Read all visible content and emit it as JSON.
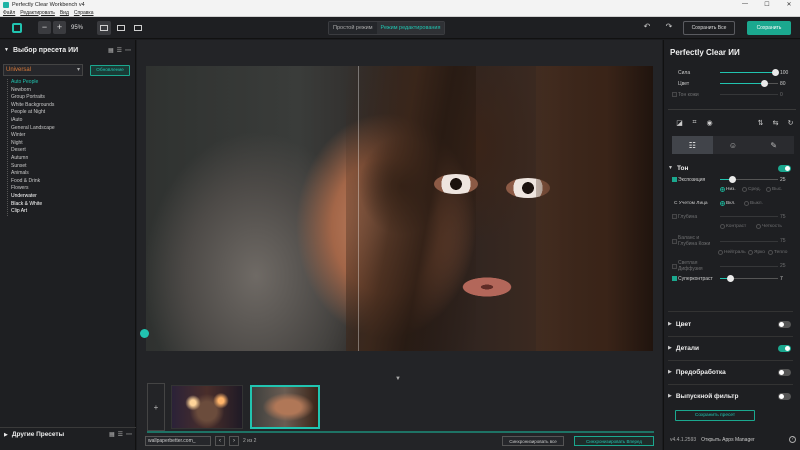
{
  "window": {
    "title": "Perfectly Clear Workbench v4",
    "minimize": "—",
    "maximize": "☐",
    "close": "✕"
  },
  "menu": [
    "Файл",
    "Редактировать",
    "Вид",
    "Справка"
  ],
  "toolbar": {
    "zoom_minus": "−",
    "zoom_plus": "+",
    "zoom_value": "95%",
    "mode_simple": "Простой режим",
    "mode_edit": "Режим редактирования",
    "undo": "↶",
    "redo": "↷",
    "save_all": "Сохранить Все",
    "save": "Сохранить"
  },
  "left_panel": {
    "title": "Выбор пресета ИИ",
    "selected_preset": "Universal",
    "refresh_label": "Обновление",
    "presets": [
      "Auto People",
      "Newborn",
      "Group Portraits",
      "White Backgrounds",
      "People at Night",
      "iAuto",
      "General Landscape",
      "Winter",
      "Night",
      "Desert",
      "Autumn",
      "Sunset",
      "Animals",
      "Food & Drink",
      "Flowers",
      "Underwater",
      "Black & White",
      "Clip Art"
    ],
    "other_presets": "Другие Пресеты"
  },
  "bottom": {
    "file_name": "wallpaperbetter.com_",
    "prev": "‹",
    "next": "›",
    "count": "2 из 2",
    "sync_all": "Синхронизировать все",
    "sync_prev": "Синхронизировать Вперед"
  },
  "right_panel": {
    "title": "Perfectly Clear ИИ",
    "sliders": [
      {
        "label": "Сила",
        "value": "100",
        "fraction": 0.95
      },
      {
        "label": "Цвет",
        "value": "80",
        "fraction": 0.76
      }
    ],
    "skin_tone": {
      "label": "Тон кожи",
      "value": "0"
    },
    "tone": {
      "title": "Тон",
      "exposure": {
        "label": "Экспозиция",
        "value": "25",
        "fraction": 0.2
      },
      "exposure_modes": [
        "Низ.",
        "Сред.",
        "Выс."
      ],
      "face_aware_label": "С Учетом Лица",
      "face_aware_modes": [
        "Вкл.",
        "Выкл."
      ],
      "depth": {
        "label": "Глубина",
        "value": "75"
      },
      "depth_modes": [
        "Контраст",
        "Четкость"
      ],
      "skin_balance": {
        "label": "Баланс и Глубина Кожи",
        "value": "75"
      },
      "skin_modes": [
        "Нейтраль",
        "Ярко",
        "Тепло"
      ],
      "light_diffusion": {
        "label": "Светлая Диффузия",
        "value": "25"
      },
      "supercontrast": {
        "label": "Суперконтраст",
        "value": "7",
        "fraction": 0.18
      }
    },
    "sections": [
      {
        "title": "Цвет",
        "on": false
      },
      {
        "title": "Детали",
        "on": true
      },
      {
        "title": "Предобработка",
        "on": false
      },
      {
        "title": "Выпускной фильтр",
        "on": false
      }
    ],
    "save_preset": "Сохранить пресет",
    "version": "v4.4.1.2593",
    "apps_manager": "Открыть Apps Manager",
    "help": "?"
  },
  "colors": {
    "accent": "#1ba88f",
    "accent_text": "#21c4b0",
    "panel": "#1e1f22",
    "canvas": "#232427"
  }
}
